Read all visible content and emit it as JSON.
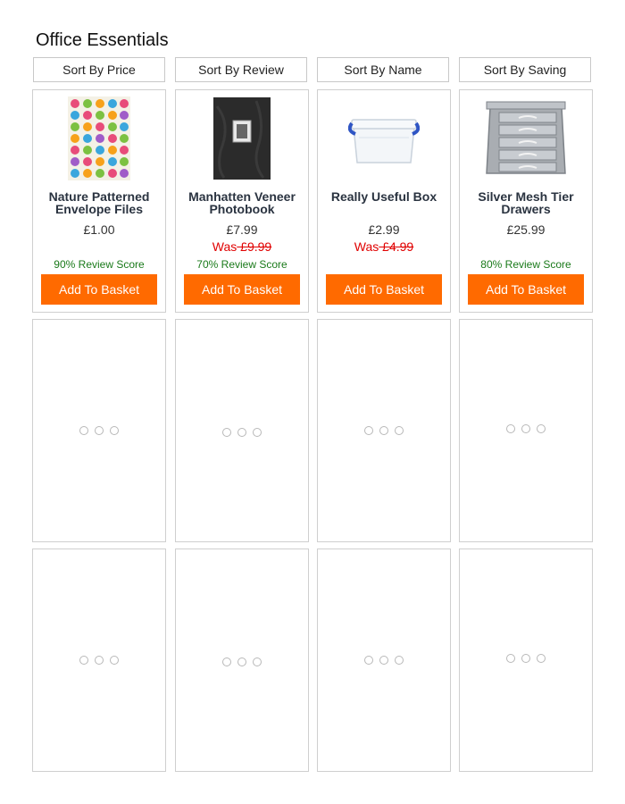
{
  "page": {
    "title": "Office Essentials"
  },
  "sort_buttons": [
    {
      "label": "Sort By Price"
    },
    {
      "label": "Sort By Review"
    },
    {
      "label": "Sort By Name"
    },
    {
      "label": "Sort By Saving"
    }
  ],
  "products": [
    {
      "name": "Nature Patterned Envelope Files",
      "price": "£1.00",
      "was_label": "",
      "was_price": "",
      "review": "90% Review Score",
      "button": "Add To Basket",
      "image": "owl-pattern-envelope-icon"
    },
    {
      "name": "Manhatten Veneer Photobook",
      "price": "£7.99",
      "was_label": "Was",
      "was_price": " £9.99 ",
      "review": "70% Review Score",
      "button": "Add To Basket",
      "image": "photobook-icon"
    },
    {
      "name": "Really Useful Box",
      "price": "£2.99",
      "was_label": "Was",
      "was_price": " £4.99 ",
      "review": "",
      "button": "Add To Basket",
      "image": "clear-storage-box-icon"
    },
    {
      "name": "Silver Mesh Tier Drawers",
      "price": "£25.99",
      "was_label": "",
      "was_price": "",
      "review": "80% Review Score",
      "button": "Add To Basket",
      "image": "mesh-drawers-icon"
    }
  ],
  "colors": {
    "accent": "#ff6a00",
    "was_price": "#e00000",
    "review": "#1a7a1a",
    "border": "#cfcfcf"
  },
  "loader_icon": "loading-dots-icon"
}
